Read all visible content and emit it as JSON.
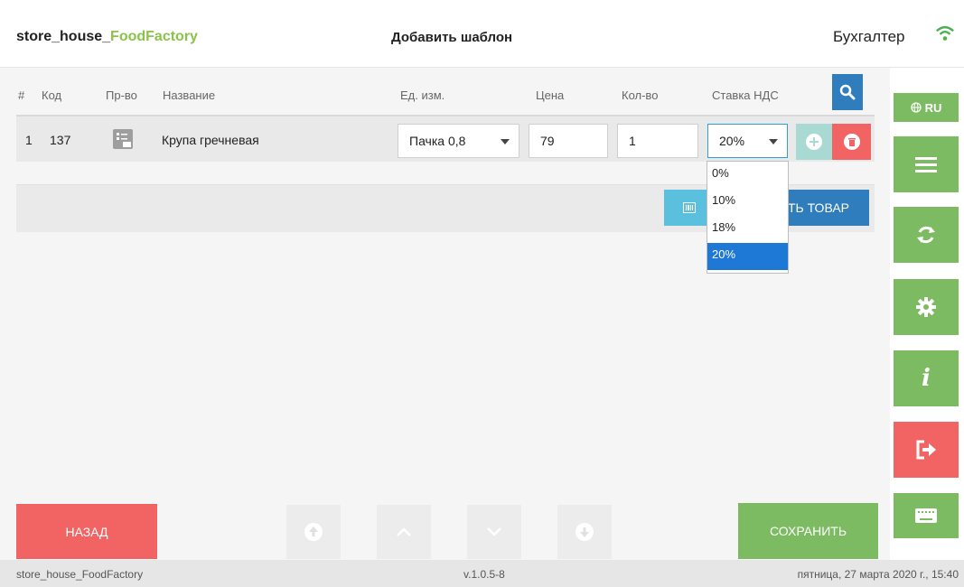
{
  "header": {
    "app_prefix": "store_house_",
    "app_accent": "FoodFactory",
    "page_title": "Добавить шаблон",
    "role": "Бухгалтер",
    "wifi_icon": "wifi-icon"
  },
  "table": {
    "columns": [
      "#",
      "Код",
      "Пр-во",
      "Название",
      "Ед. изм.",
      "Цена",
      "Кол-во",
      "Ставка НДС"
    ],
    "row": {
      "num": "1",
      "code": "137",
      "name": "Крупа гречневая",
      "unit": "Пачка 0,8",
      "price": "79",
      "qty": "1",
      "vat": "20%"
    }
  },
  "vat_options": [
    "0%",
    "10%",
    "18%",
    "20%"
  ],
  "vat_selected": "20%",
  "panel": {
    "add_product_label": "ТЬ ТОВАР"
  },
  "sidebar": {
    "lang": "RU"
  },
  "bottom": {
    "back_label": "НАЗАД",
    "save_label": "СОХРАНИТЬ"
  },
  "footer": {
    "app_name": "store_house_FoodFactory",
    "version": "v.1.0.5-8",
    "datetime": "пятница, 27 марта 2020 г., 15:40"
  },
  "colors": {
    "accent_green": "#7dbb63",
    "accent_blue": "#2f7dbd",
    "danger_red": "#f26464",
    "select_blue": "#1e78d6"
  }
}
